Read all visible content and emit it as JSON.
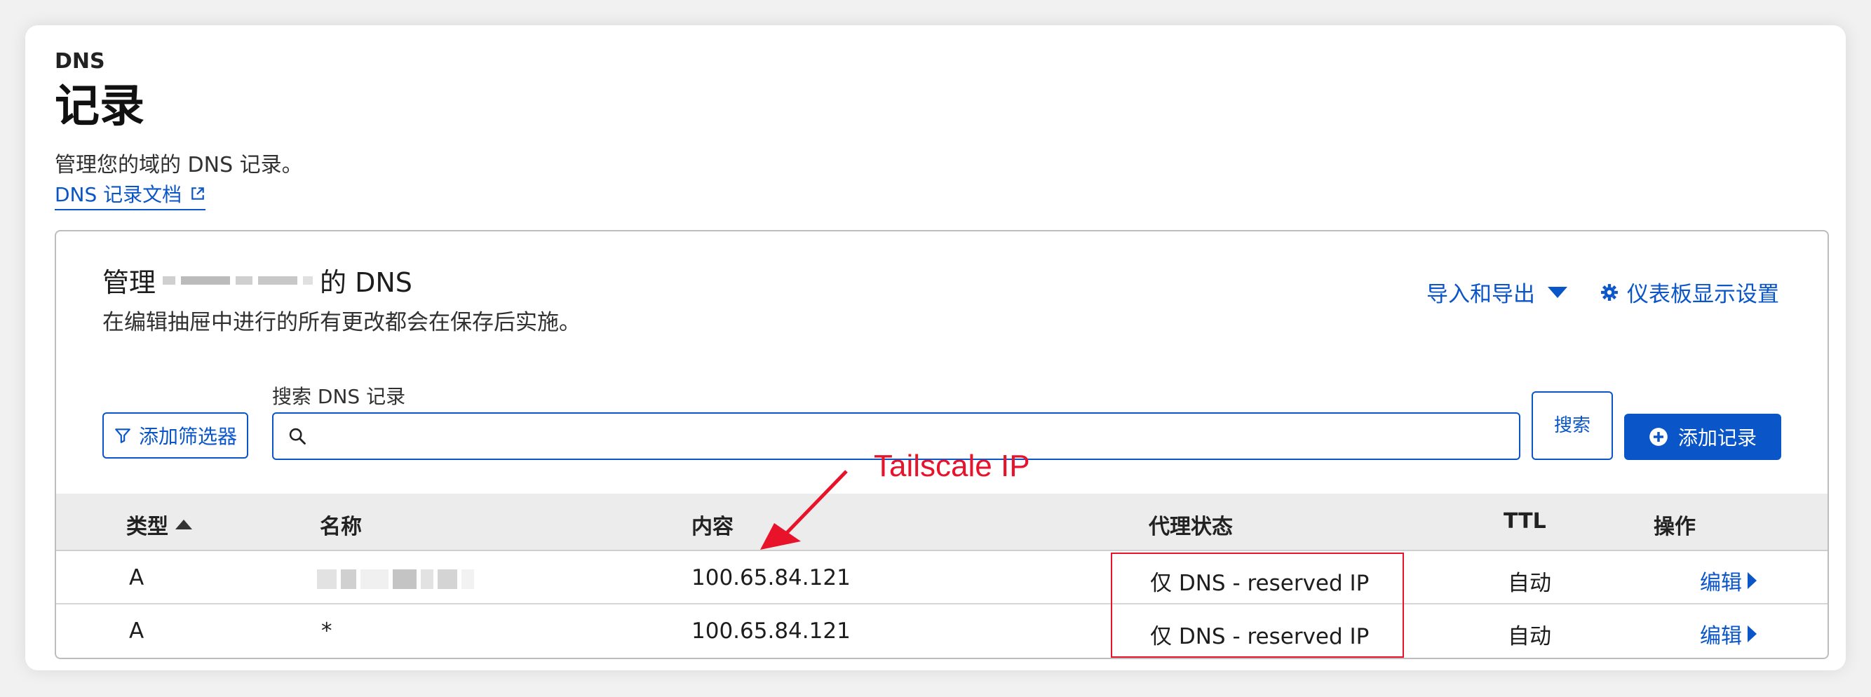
{
  "header": {
    "eyebrow": "DNS",
    "title": "记录",
    "description": "管理您的域的 DNS 记录。",
    "doc_link": "DNS 记录文档"
  },
  "panel": {
    "title_prefix": "管理",
    "title_suffix": "的 DNS",
    "subtitle": "在编辑抽屉中进行的所有更改都会在保存后实施。",
    "export_label": "导入和导出",
    "settings_label": "仪表板显示设置"
  },
  "toolbar": {
    "filter_label": "添加筛选器",
    "search_label": "搜索 DNS 记录",
    "search_placeholder": "",
    "search_button": "搜索",
    "add_button": "添加记录"
  },
  "annotation": {
    "text": "Tailscale IP",
    "color": "#e8132b"
  },
  "table": {
    "columns": [
      "类型",
      "名称",
      "内容",
      "代理状态",
      "TTL",
      "操作"
    ],
    "rows": [
      {
        "type": "A",
        "name": "",
        "content": "100.65.84.121",
        "proxy": "仅 DNS - reserved IP",
        "ttl": "自动",
        "action": "编辑"
      },
      {
        "type": "A",
        "name": "*",
        "content": "100.65.84.121",
        "proxy": "仅 DNS - reserved IP",
        "ttl": "自动",
        "action": "编辑"
      }
    ]
  },
  "colors": {
    "accent": "#0a55c8",
    "annotation_red": "#e8132b"
  }
}
